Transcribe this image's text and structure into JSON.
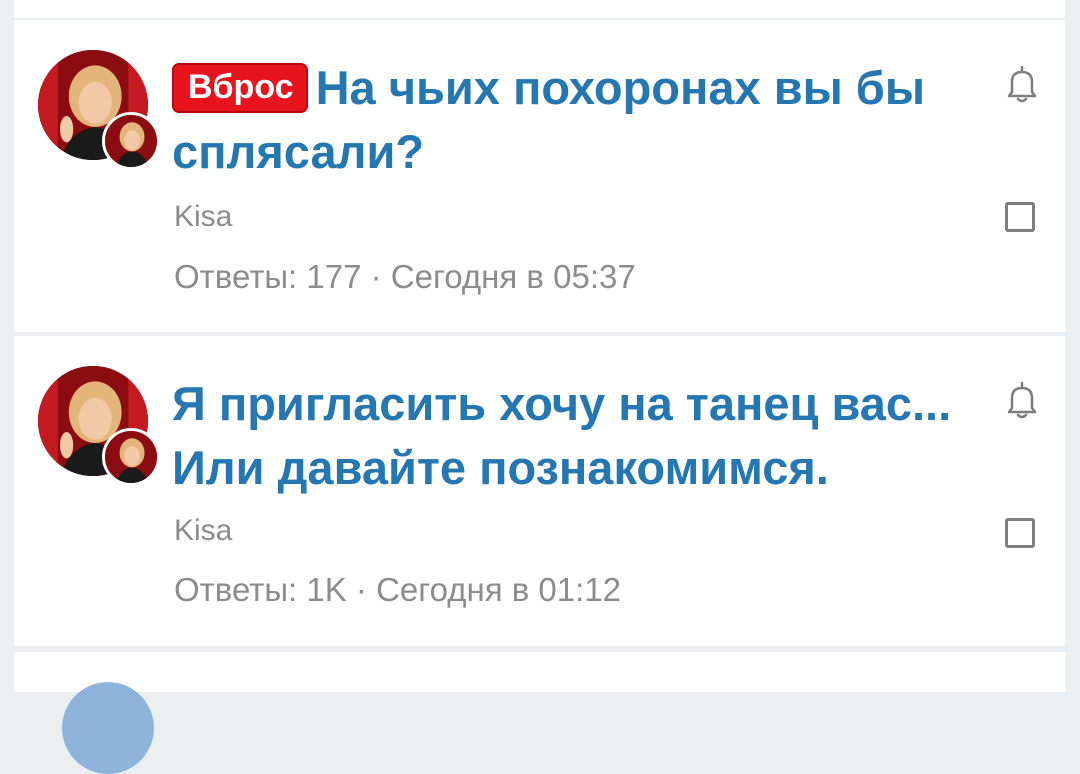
{
  "threads": [
    {
      "badge": "Вброс",
      "title": "На чьих похоронах вы бы сплясали?",
      "author": "Kisa",
      "replies_label": "Ответы:",
      "replies": "177",
      "separator": "·",
      "time": "Сегодня в 05:37"
    },
    {
      "badge": "",
      "title": "Я пригласить хочу на танец вас... Или давайте познакомимся.",
      "author": "Kisa",
      "replies_label": "Ответы:",
      "replies": "1K",
      "separator": "·",
      "time": "Сегодня в 01:12"
    }
  ],
  "icons": {
    "bell": "bell-icon",
    "checkbox": "checkbox-icon",
    "avatar": "avatar"
  },
  "colors": {
    "title": "#2577b1",
    "badge_bg": "#e8141d",
    "meta": "#8c8c8c",
    "background": "#eceff1"
  }
}
